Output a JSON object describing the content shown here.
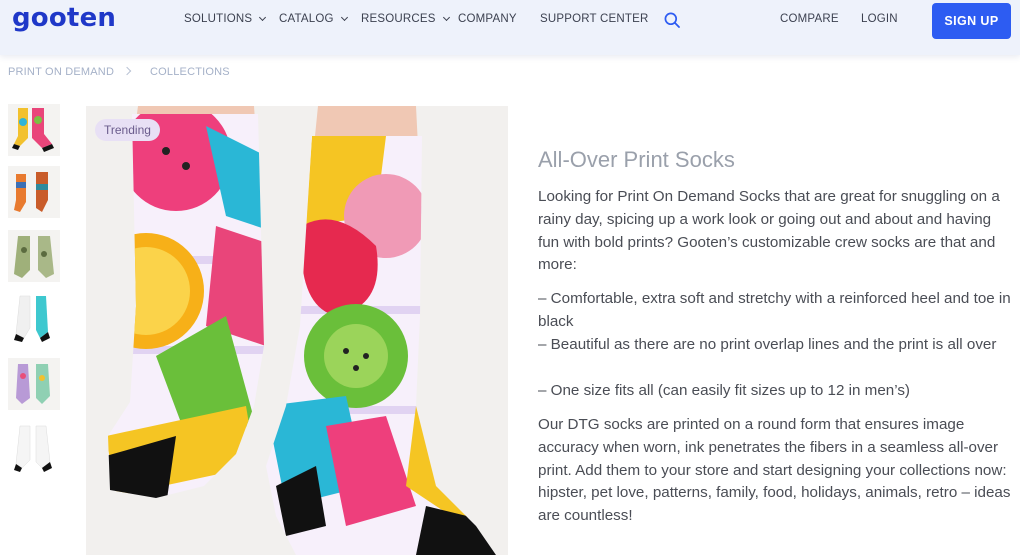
{
  "header": {
    "logo": "gooten",
    "nav": [
      {
        "label": "SOLUTIONS",
        "dropdown": true
      },
      {
        "label": "CATALOG",
        "dropdown": true
      },
      {
        "label": "RESOURCES",
        "dropdown": true
      },
      {
        "label": "COMPANY",
        "dropdown": false
      },
      {
        "label": "SUPPORT CENTER",
        "dropdown": false
      }
    ],
    "search_icon": "search-icon",
    "compare": "COMPARE",
    "login": "LOGIN",
    "signup": "SIGN UP",
    "accent_color": "#2d5cf2"
  },
  "breadcrumb": {
    "items": [
      "PRINT ON DEMAND",
      "COLLECTIONS"
    ]
  },
  "gallery": {
    "badge": "Trending",
    "thumbnail_count": 6
  },
  "product": {
    "title": "All-Over Print Socks",
    "intro": "Looking for Print On Demand Socks that are great for snuggling on a rainy day, spicing up a work look or going out and about and having fun with bold prints? Gooten’s customizable crew socks are that and more:",
    "features": [
      "– Comfortable, extra soft and stretchy with a reinforced heel and toe in black",
      "– Beautiful as there are no print overlap lines and the print is all over",
      "– One size fits all (can easily fit sizes up to 12 in men’s)"
    ],
    "details": "Our DTG socks are printed on a round form that ensures image accuracy when worn, ink penetrates the fibers in a seamless all-over print. Add them to your store and start designing your collections now: hipster, pet love, patterns, family, food, holidays, animals, retro – ideas are countless!"
  }
}
